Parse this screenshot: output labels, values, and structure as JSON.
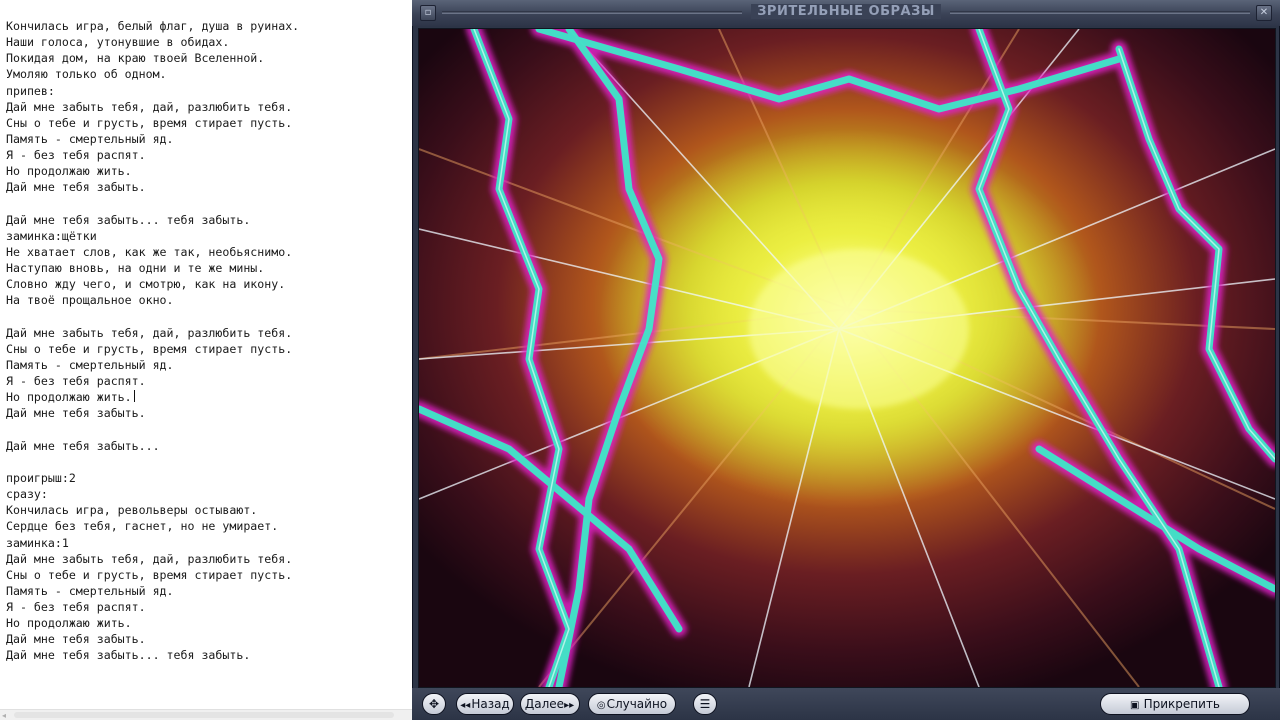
{
  "editor": {
    "lines": [
      "Кончилась игра, белый флаг, душа в руинах.",
      "Наши голоса, утонувшие в обидах.",
      "Покидая дом, на краю твоей Вселенной.",
      "Умоляю только об одном.",
      "припев:",
      "Дай мне забыть тебя, дай, разлюбить тебя.",
      "Сны о тебе и грусть, время стирает пусть.",
      "Память - смертельный яд.",
      "Я - без тебя распят.",
      "Но продолжаю жить.",
      "Дай мне тебя забыть.",
      "",
      "Дай мне тебя забыть... тебя забыть.",
      "заминка:щётки",
      "Не хватает слов, как же так, необьяснимо.",
      "Наступаю вновь, на одни и те же мины.",
      "Словно жду чего, и смотрю, как на икону.",
      "На твоё прощальное окно.",
      "",
      "Дай мне забыть тебя, дай, разлюбить тебя.",
      "Сны о тебе и грусть, время стирает пусть.",
      "Память - смертельный яд.",
      "Я - без тебя распят.",
      "Но продолжаю жить.",
      "Дай мне тебя забыть.",
      "",
      "Дай мне тебя забыть...",
      "",
      "проигрыш:2",
      "сразу:",
      "Кончилась игра, револьверы остывают.",
      "Сердце без тебя, гаснет, но не умирает.",
      "заминка:1",
      "Дай мне забыть тебя, дай, разлюбить тебя.",
      "Сны о тебе и грусть, время стирает пусть.",
      "Память - смертельный яд.",
      "Я - без тебя распят.",
      "Но продолжаю жить.",
      "Дай мне тебя забыть.",
      "Дай мне тебя забыть... тебя забыть."
    ]
  },
  "visualizer": {
    "title": "ЗРИТЕЛЬНЫЕ ОБРАЗЫ",
    "buttons": {
      "back": "Назад",
      "next": "Далее",
      "random": "Случайно",
      "pin": "Прикрепить"
    },
    "colors": {
      "chrome": "#2c3446",
      "title_text": "#95a0b8",
      "magenta": "#e020c8",
      "cyan": "#3ee8c8",
      "yellow": "#f2f040"
    }
  }
}
